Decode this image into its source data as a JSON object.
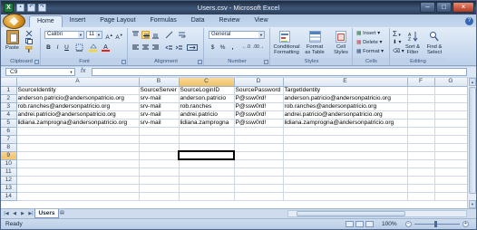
{
  "window": {
    "title": "Users.csv - Microsoft Excel"
  },
  "tabs": [
    "Home",
    "Insert",
    "Page Layout",
    "Formulas",
    "Data",
    "Review",
    "View"
  ],
  "ribbon": {
    "clipboard": {
      "paste": "Paste",
      "label": "Clipboard"
    },
    "font": {
      "name": "Calibri",
      "size": "11",
      "label": "Font",
      "bold": "B",
      "italic": "I",
      "underline": "U"
    },
    "alignment": {
      "label": "Alignment"
    },
    "number": {
      "format": "General",
      "label": "Number",
      "currency": "$",
      "percent": "%",
      "comma": ","
    },
    "styles": {
      "conditional": [
        "Conditional",
        "Formatting"
      ],
      "table": [
        "Format",
        "as Table"
      ],
      "cell": [
        "Cell",
        "Styles"
      ],
      "label": "Styles"
    },
    "cells": {
      "insert": "Insert",
      "delete": "Delete",
      "format": "Format",
      "label": "Cells"
    },
    "editing": {
      "sum": "Σ",
      "sort": [
        "Sort &",
        "Filter"
      ],
      "find": [
        "Find &",
        "Select"
      ],
      "label": "Editing"
    }
  },
  "formula_bar": {
    "name_box": "C9",
    "fx": "fx",
    "value": ""
  },
  "columns": [
    "A",
    "B",
    "C",
    "D",
    "E",
    "F",
    "G"
  ],
  "rows": [
    [
      "SourceIdentity",
      "SourceServer",
      "SourceLoginID",
      "SourcePassword",
      "TargetIdentity",
      "",
      ""
    ],
    [
      "anderson.patricio@andersonpatricio.org",
      "srv-mail",
      "anderson.patricio",
      "P@ssw0rd!",
      "anderson.patricio@andersonpatricio.org",
      "",
      ""
    ],
    [
      "rob.ranches@andersonpatricio.org",
      "srv-mail",
      "rob.ranches",
      "P@ssw0rd!",
      "rob.ranches@andersonpatricio.org",
      "",
      ""
    ],
    [
      "andrei.patricio@andersonpatricio.org",
      "srv-mail",
      "andrei.patricio",
      "P@ssw0rd!",
      "andrei.patricio@andersonpatricio.org",
      "",
      ""
    ],
    [
      "lidiana.zamprogna@andersonpatricio.org",
      "srv-mail",
      "lidiana.zamprogna",
      "P@ssw0rd!",
      "lidiana.zamprogna@andersonpatricio.org",
      "",
      ""
    ],
    [
      "",
      "",
      "",
      "",
      "",
      "",
      ""
    ],
    [
      "",
      "",
      "",
      "",
      "",
      "",
      ""
    ],
    [
      "",
      "",
      "",
      "",
      "",
      "",
      ""
    ],
    [
      "",
      "",
      "",
      "",
      "",
      "",
      ""
    ],
    [
      "",
      "",
      "",
      "",
      "",
      "",
      ""
    ],
    [
      "",
      "",
      "",
      "",
      "",
      "",
      ""
    ],
    [
      "",
      "",
      "",
      "",
      "",
      "",
      ""
    ],
    [
      "",
      "",
      "",
      "",
      "",
      "",
      ""
    ],
    [
      "",
      "",
      "",
      "",
      "",
      "",
      ""
    ]
  ],
  "active_cell": {
    "row": 9,
    "col": "C"
  },
  "sheets": [
    "Users"
  ],
  "status": {
    "text": "Ready",
    "zoom": "100%"
  }
}
